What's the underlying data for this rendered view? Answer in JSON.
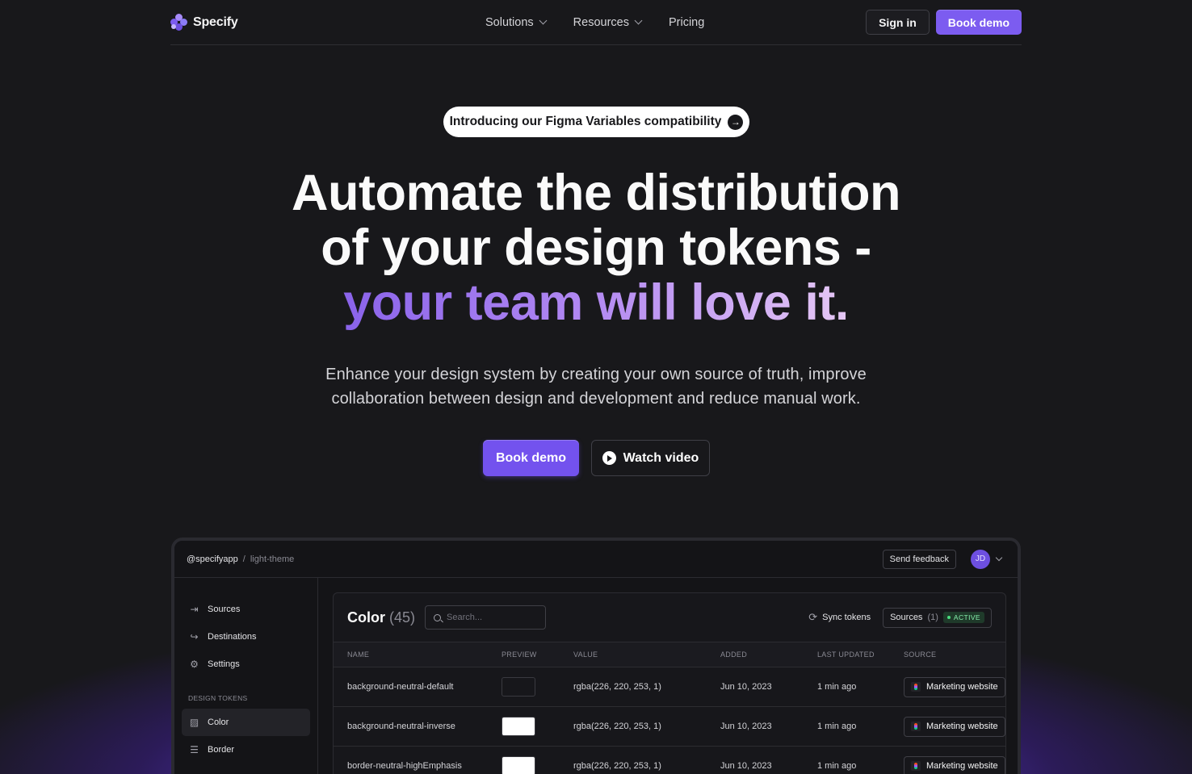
{
  "brand": {
    "name": "Specify",
    "accent": "#7c5cf0"
  },
  "nav": {
    "items": [
      {
        "label": "Solutions",
        "has_dropdown": true
      },
      {
        "label": "Resources",
        "has_dropdown": true
      },
      {
        "label": "Pricing",
        "has_dropdown": false
      }
    ],
    "sign_in": "Sign in",
    "book_demo": "Book demo"
  },
  "hero": {
    "announcement": "Introducing our Figma Variables compatibility",
    "headline_line1": "Automate the distribution",
    "headline_line2": "of your design tokens -",
    "headline_line3": "your team will love it.",
    "subtitle_line1": "Enhance your design system by creating your own source of truth, improve",
    "subtitle_line2": "collaboration between design and development and reduce manual work.",
    "cta_primary": "Book demo",
    "cta_secondary": "Watch video"
  },
  "app": {
    "breadcrumb_org": "@specifyapp",
    "breadcrumb_sep": "/",
    "breadcrumb_repo": "light-theme",
    "send_feedback": "Send feedback",
    "avatar_initials": "JD",
    "sidebar": {
      "items": [
        {
          "label": "Sources",
          "icon": "sign-in-arrow-icon"
        },
        {
          "label": "Destinations",
          "icon": "sign-out-arrow-icon"
        },
        {
          "label": "Settings",
          "icon": "gear-icon"
        }
      ],
      "section_title": "DESIGN TOKENS",
      "token_items": [
        {
          "label": "Color",
          "icon": "palette-icon",
          "active": true
        },
        {
          "label": "Border",
          "icon": "border-lines-icon",
          "active": false
        }
      ]
    },
    "panel": {
      "title": "Color",
      "count": "(45)",
      "search_placeholder": "Search...",
      "sync_tokens": "Sync tokens",
      "sources_label": "Sources",
      "sources_count": "(1)",
      "active_badge": "ACTIVE",
      "columns": [
        "NAME",
        "PREVIEW",
        "VALUE",
        "ADDED",
        "LAST UPDATED",
        "SOURCE"
      ],
      "rows": [
        {
          "name": "background-neutral-default",
          "preview_color": "#17171b",
          "value": "rgba(226, 220, 253, 1)",
          "added": "Jun 10, 2023",
          "updated": "1 min ago",
          "source": "Marketing website"
        },
        {
          "name": "background-neutral-inverse",
          "preview_color": "#ffffff",
          "value": "rgba(226, 220, 253, 1)",
          "added": "Jun 10, 2023",
          "updated": "1 min ago",
          "source": "Marketing website"
        },
        {
          "name": "border-neutral-highEmphasis",
          "preview_color": "#ffffff",
          "value": "rgba(226, 220, 253, 1)",
          "added": "Jun 10, 2023",
          "updated": "1 min ago",
          "source": "Marketing website"
        }
      ]
    }
  }
}
